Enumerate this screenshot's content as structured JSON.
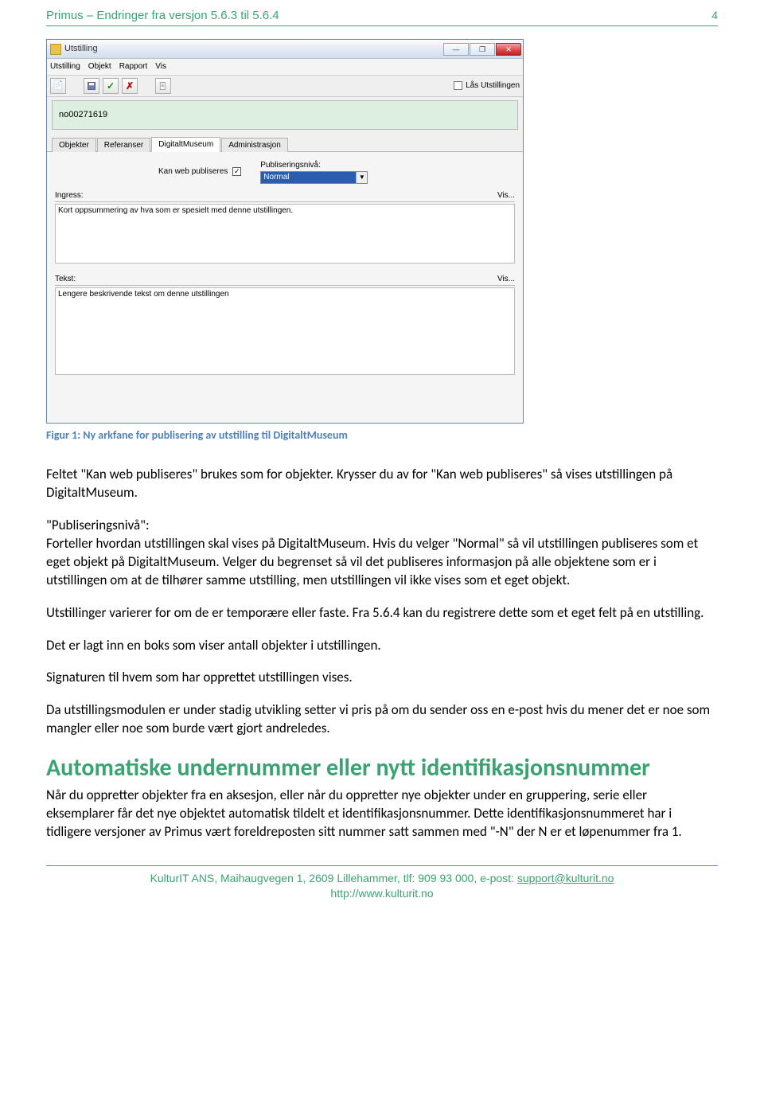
{
  "header": {
    "title": "Primus – Endringer fra versjon 5.6.3 til 5.6.4",
    "page_number": "4"
  },
  "app": {
    "window_title": "Utstilling",
    "menus": [
      "Utstilling",
      "Objekt",
      "Rapport",
      "Vis"
    ],
    "lock_label": "Lås Utstillingen",
    "id_value": "no00271619",
    "subtabs": [
      "Objekter",
      "Referanser",
      "DigitaltMuseum",
      "Administrasjon"
    ],
    "kwp_label": "Kan web publiseres",
    "pn_label": "Publiseringsnivå:",
    "pn_value": "Normal",
    "ingress": {
      "label": "Ingress:",
      "vis": "Vis...",
      "value": "Kort oppsummering av hva som er spesielt med denne utstillingen."
    },
    "tekst": {
      "label": "Tekst:",
      "vis": "Vis...",
      "value": "Lengere beskrivende tekst om denne utstillingen"
    }
  },
  "caption": "Figur 1: Ny arkfane for publisering av utstilling til DigitaltMuseum",
  "para1": "Feltet \"Kan web publiseres\" brukes som for objekter. Krysser du av for \"Kan web publiseres\" så vises utstillingen på DigitaltMuseum.",
  "para2": "\"Publiseringsnivå\":",
  "para3": "Forteller hvordan utstillingen skal vises på DigitaltMuseum. Hvis du velger \"Normal\" så vil utstillingen publiseres som et eget objekt på DigitaltMuseum. Velger du begrenset så vil det publiseres informasjon på alle objektene som er i utstillingen om at de tilhører samme utstilling, men utstillingen vil ikke vises som et eget objekt.",
  "para4": "Utstillinger varierer for om de er temporære eller faste. Fra 5.6.4 kan du registrere dette som et eget felt på en utstilling.",
  "para5": "Det er lagt inn en boks som viser antall objekter i utstillingen.",
  "para6": "Signaturen til hvem som har opprettet utstillingen vises.",
  "para7": "Da utstillingsmodulen er under stadig utvikling setter vi pris på om du sender oss en e-post hvis du mener det er noe som mangler eller noe som burde vært gjort andreledes.",
  "section_title": "Automatiske undernummer eller nytt identifikasjonsnummer",
  "para8": "Når du oppretter objekter fra en aksesjon, eller når du oppretter nye objekter under en gruppering, serie eller eksemplarer får det nye objektet automatisk tildelt et identifikasjonsnummer. Dette identifikasjonsnummeret har i tidligere versjoner av Primus vært foreldreposten sitt nummer satt sammen med \"-N\" der N er et løpenummer fra 1.",
  "footer": {
    "line1a": "KulturIT ANS, Maihaugvegen 1, 2609 Lillehammer, tlf: 909 93 000, e-post: ",
    "email": "support@kulturit.no",
    "line2": "http://www.kulturit.no"
  }
}
